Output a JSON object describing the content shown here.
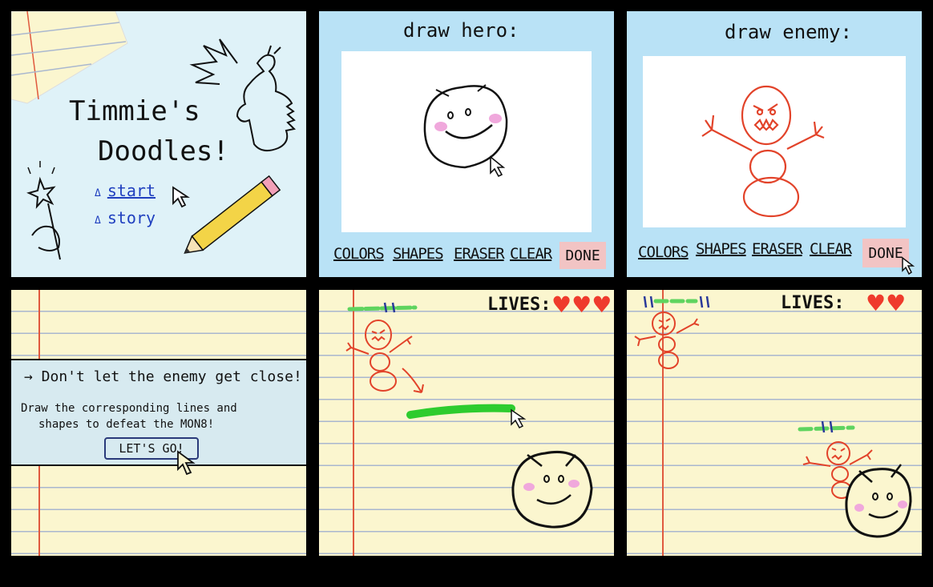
{
  "title_screen": {
    "title_line1": "Timmie's",
    "title_line2": "Doodles!",
    "menu": [
      {
        "marker": "Δ",
        "label": "start"
      },
      {
        "marker": "Δ",
        "label": "story"
      }
    ]
  },
  "draw_hero": {
    "heading": "draw hero:",
    "tools": [
      "COLORS",
      "SHAPES",
      "ERASER",
      "CLEAR"
    ],
    "done_label": "DONE"
  },
  "draw_enemy": {
    "heading": "draw enemy:",
    "tools": [
      "COLORS",
      "SHAPES",
      "ERASER",
      "CLEAR"
    ],
    "done_label": "DONE"
  },
  "instructions": {
    "headline": "→ Don't let the enemy get close!",
    "body_line1": "Draw the corresponding lines and",
    "body_line2": "shapes to defeat the MON8!",
    "go_label": "LET'S GO!"
  },
  "gameplay_1": {
    "lives_label": "LIVES:",
    "hearts": 3
  },
  "gameplay_2": {
    "lives_label": "LIVES:",
    "hearts": 2
  },
  "colors": {
    "sky_blue": "#b9e2f6",
    "paper_yellow": "#fbf6cf",
    "enemy_red": "#e2432a",
    "heart_red": "#ef3b2c",
    "ink_blue": "#1f3fbf",
    "done_pink": "#f2c4c4",
    "slash_green": "#2ecc2e"
  }
}
